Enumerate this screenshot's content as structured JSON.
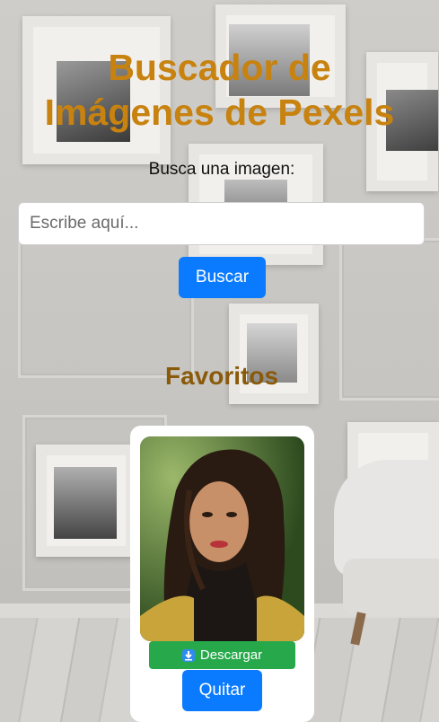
{
  "header": {
    "title_line1": "Buscador de",
    "title_line2": "Imágenes de Pexels"
  },
  "search": {
    "label": "Busca una imagen:",
    "placeholder": "Escribe aquí...",
    "value": "",
    "button_label": "Buscar"
  },
  "favorites": {
    "title": "Favoritos",
    "items": [
      {
        "download_label": "Descargar",
        "remove_label": "Quitar"
      }
    ]
  },
  "colors": {
    "title": "#c7820f",
    "favorites_title": "#8a5a0b",
    "primary_button": "#0a7bff",
    "download_button": "#27a94b"
  }
}
